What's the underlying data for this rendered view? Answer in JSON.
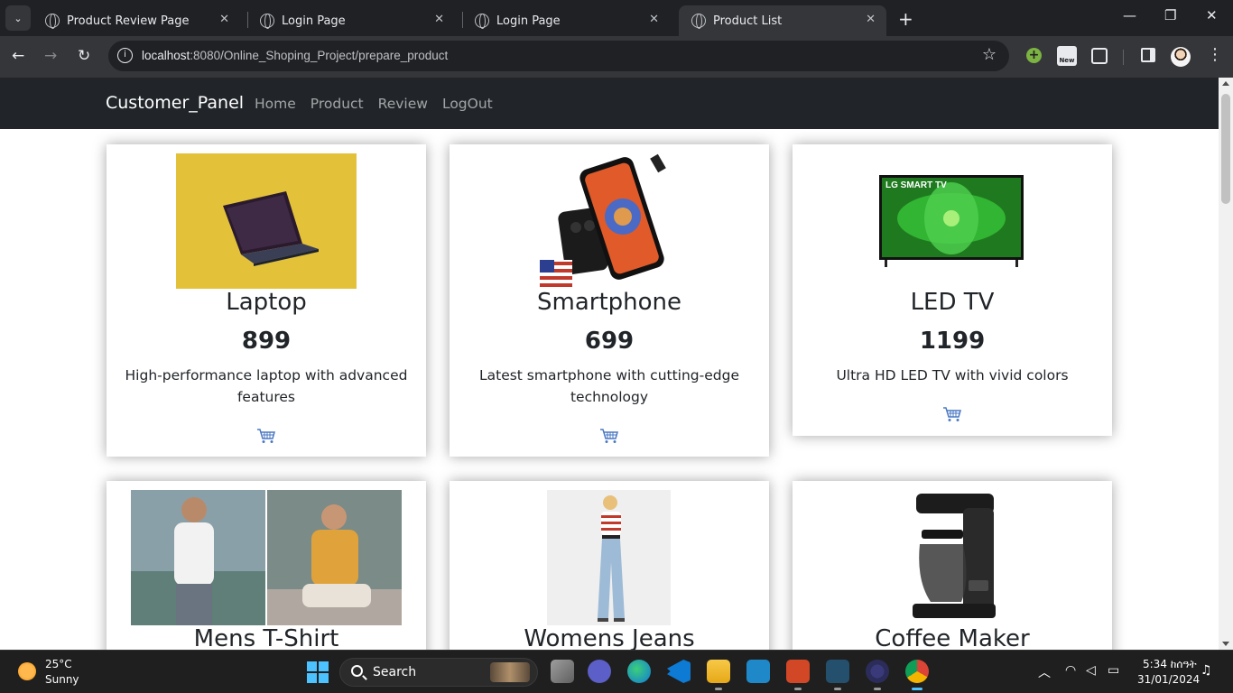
{
  "browser": {
    "tabs": [
      {
        "title": "Product Review Page",
        "active": false
      },
      {
        "title": "Login Page",
        "active": false
      },
      {
        "title": "Login Page",
        "active": false
      },
      {
        "title": "Product List",
        "active": true
      }
    ],
    "tab_close_glyph": "✕",
    "new_tab_glyph": "+",
    "url_host": "localhost",
    "url_rest": ":8080/Online_Shoping_Project/prepare_product",
    "extension_new_badge": "New",
    "window_controls": {
      "minimize": "—",
      "restore": "❐",
      "close": "✕"
    }
  },
  "page": {
    "navbar": {
      "brand": "Customer_Panel",
      "links": [
        "Home",
        "Product",
        "Review",
        "LogOut"
      ]
    },
    "products": [
      {
        "name": "Laptop",
        "price": "899",
        "description": "High-performance laptop with advanced features"
      },
      {
        "name": "Smartphone",
        "price": "699",
        "description": "Latest smartphone with cutting-edge technology"
      },
      {
        "name": "LED TV",
        "price": "1199",
        "description": "Ultra HD LED TV with vivid colors",
        "image_text": "LG SMART TV"
      },
      {
        "name": "Mens T-Shirt"
      },
      {
        "name": "Womens Jeans"
      },
      {
        "name": "Coffee Maker"
      }
    ],
    "icons": {
      "cart": "shopping-cart-icon"
    },
    "colors": {
      "navbar_bg": "#212529",
      "laptop_bg": "#e3c23a",
      "cart_icon": "#4a78c2"
    }
  },
  "taskbar": {
    "weather_temp": "25°C",
    "weather_desc": "Sunny",
    "search_label": "Search",
    "time": "5:34 ከሰዓት",
    "date": "31/01/2024"
  }
}
